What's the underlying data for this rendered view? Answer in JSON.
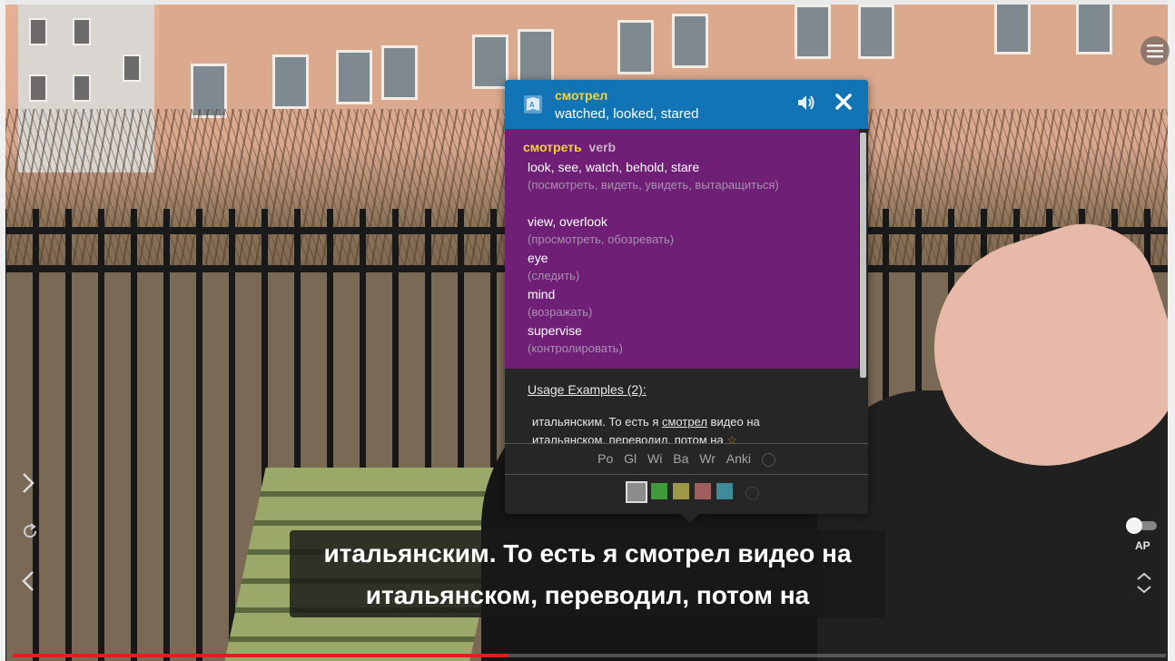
{
  "popup": {
    "word": "смотрел",
    "translation": "watched, looked, stared",
    "lemma": "смотреть",
    "part_of_speech": "verb",
    "senses": [
      {
        "en": "look, see, watch, behold, stare",
        "ru": "(посмотреть, видеть, увидеть, вытаращиться)"
      },
      {
        "en": "view, overlook",
        "ru": "(просмотреть, обозревать)"
      },
      {
        "en": "eye",
        "ru": "(следить)"
      },
      {
        "en": "mind",
        "ru": "(возражать)"
      },
      {
        "en": "supervise",
        "ru": "(контролировать)"
      }
    ],
    "usage_examples_title": "Usage Examples (2):",
    "example": {
      "before": "итальянским. То есть я ",
      "word": "смотрел",
      "after": " видео на итальянском, переводил, потом на",
      "star": "☆"
    },
    "links": [
      "Po",
      "Gl",
      "Wi",
      "Ba",
      "Wr",
      "Anki"
    ],
    "swatch_colors": [
      "#8c8c8c",
      "#3f9a3a",
      "#9c9848",
      "#a15c5c",
      "#3e8a96"
    ],
    "header_color": "#1374b5",
    "body_color": "#6f1f76"
  },
  "subtitle": {
    "line1": "итальянским. То есть я смотрел видео на",
    "line2": "итальянском, переводил, потом на"
  },
  "player": {
    "autopause_label": "AP",
    "progress": 0.43
  },
  "icons": {
    "menu": "menu-icon",
    "dictionary": "dictionary-icon",
    "speaker": "speaker-icon",
    "close": "close-icon",
    "next": "chevron-right-icon",
    "replay": "replay-icon",
    "prev": "chevron-left-icon",
    "updown": "up-down-icon"
  }
}
